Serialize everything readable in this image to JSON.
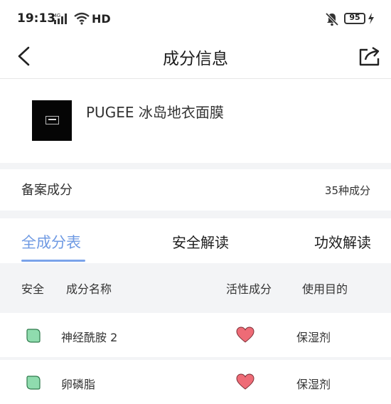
{
  "status_bar": {
    "time": "19:13",
    "network_label": "4G",
    "hd": "HD",
    "battery": "95"
  },
  "header": {
    "title": "成分信息",
    "back_icon": "chevron-left-icon",
    "share_icon": "share-icon"
  },
  "product": {
    "name": "PUGEE 冰岛地衣面膜"
  },
  "record": {
    "label": "备案成分",
    "count": "35种成分"
  },
  "tabs": [
    {
      "label": "全成分表",
      "active": true
    },
    {
      "label": "安全解读",
      "active": false
    },
    {
      "label": "功效解读",
      "active": false
    }
  ],
  "table": {
    "columns": [
      "安全",
      "成分名称",
      "活性成分",
      "使用目的"
    ],
    "rows": [
      {
        "name": "神经酰胺 2",
        "active": true,
        "purpose": "保湿剂"
      },
      {
        "name": "卵磷脂",
        "active": true,
        "purpose": "保湿剂"
      }
    ]
  },
  "colors": {
    "accent": "#6f9ae3",
    "safe_leaf": "#8fdcae",
    "heart": "#ee6b76"
  }
}
